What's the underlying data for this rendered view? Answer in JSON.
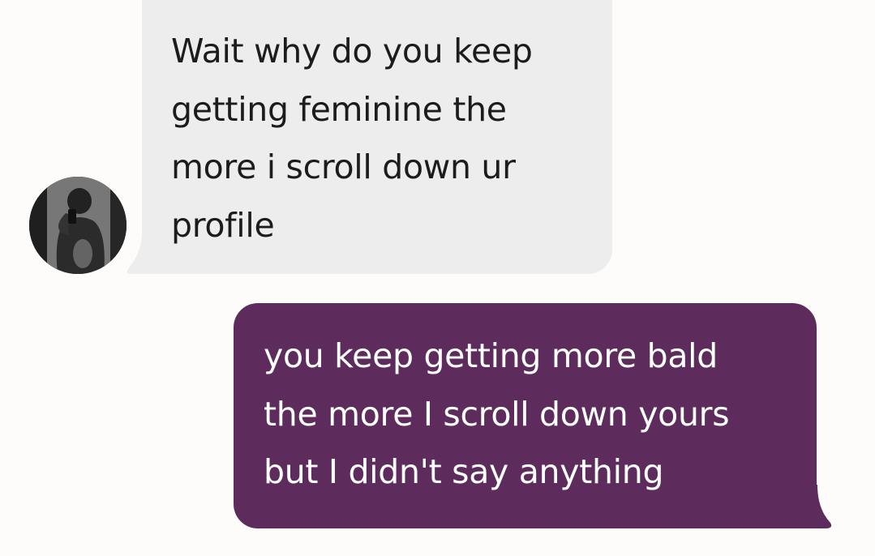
{
  "conversation": {
    "incoming": {
      "text": "Wait why do you keep\ngetting feminine the\nmore i scroll down ur\nprofile",
      "avatar_icon": "person-photo-avatar",
      "bubble_color": "#ededee",
      "text_color": "#1c1c1c"
    },
    "outgoing": {
      "text": "you keep getting more bald\nthe more I scroll down yours\nbut I didn't say anything",
      "bubble_color": "#5e2c5c",
      "text_color": "#ffffff"
    }
  }
}
